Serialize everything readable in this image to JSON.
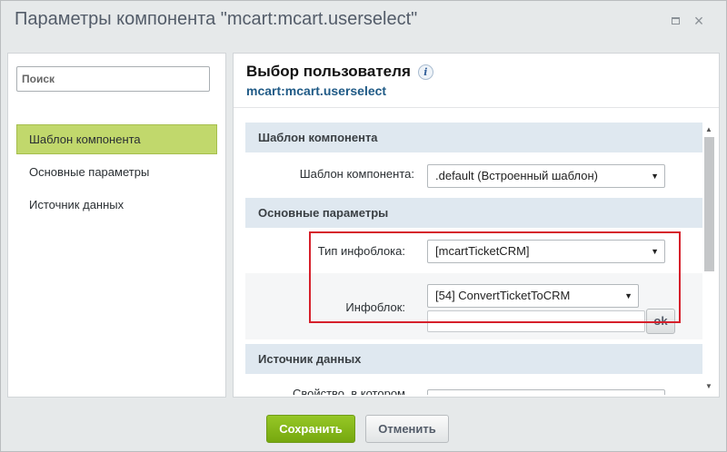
{
  "window": {
    "title": "Параметры компонента \"mcart:mcart.userselect\"",
    "maximize_icon": "maximize-icon",
    "close_icon": "close-icon",
    "close_glyph": "×"
  },
  "sidebar": {
    "search_placeholder": "Поиск",
    "items": [
      {
        "label": "Шаблон компонента",
        "active": true
      },
      {
        "label": "Основные параметры",
        "active": false
      },
      {
        "label": "Источник данных",
        "active": false
      }
    ]
  },
  "component": {
    "title": "Выбор пользователя",
    "info_glyph": "i",
    "code": "mcart:mcart.userselect"
  },
  "sections": {
    "template": {
      "heading": "Шаблон компонента",
      "field_label": "Шаблон компонента:",
      "field_value": ".default (Встроенный шаблон)"
    },
    "main": {
      "heading": "Основные параметры",
      "iblock_type_label": "Тип инфоблока:",
      "iblock_type_value": "[mcartTicketCRM]",
      "iblock_label": "Инфоблок:",
      "iblock_value": "[54] ConvertTicketToCRM",
      "ok_label": "ok"
    },
    "datasource": {
      "heading": "Источник данных",
      "field_label_partial": "Свойство, в котором"
    }
  },
  "footer": {
    "save_label": "Сохранить",
    "cancel_label": "Отменить"
  },
  "colors": {
    "accent_green": "#86b81c",
    "section_bg": "#dfe8f0",
    "highlight_red": "#d6202b",
    "link_blue": "#1f5a86"
  },
  "glyphs": {
    "dropdown_arrow": "▼",
    "scroll_up": "▲",
    "scroll_down": "▼"
  }
}
